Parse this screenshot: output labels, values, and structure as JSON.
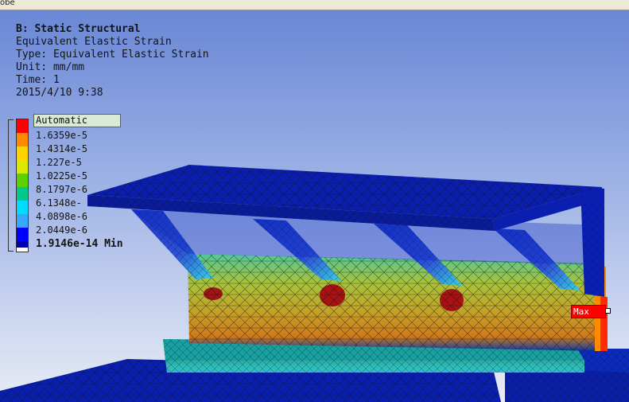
{
  "window": {
    "title_fragment": "obe"
  },
  "info": {
    "title": "B: Static Structural",
    "result": "Equivalent Elastic Strain",
    "type_line": "Type: Equivalent Elastic Strain",
    "unit_line": "Unit: mm/mm",
    "time_line": "Time: 1",
    "date": "2015/4/10 9:38"
  },
  "legend": {
    "mode": "Automatic",
    "colors": [
      "#ff0000",
      "#ff8a00",
      "#ffd200",
      "#dde800",
      "#5ed000",
      "#00c98c",
      "#00dcff",
      "#38a7ff",
      "#0000ff",
      "#0000aa"
    ],
    "ticks": [
      "1.6359e-5",
      "1.4314e-5",
      "1.227e-5",
      "1.0225e-5",
      "8.1797e-6",
      "6.1348e-",
      "4.0898e-6",
      "2.0449e-6"
    ],
    "min_label": "1.9146e-14 Min"
  },
  "probe": {
    "max_label": "Max"
  }
}
